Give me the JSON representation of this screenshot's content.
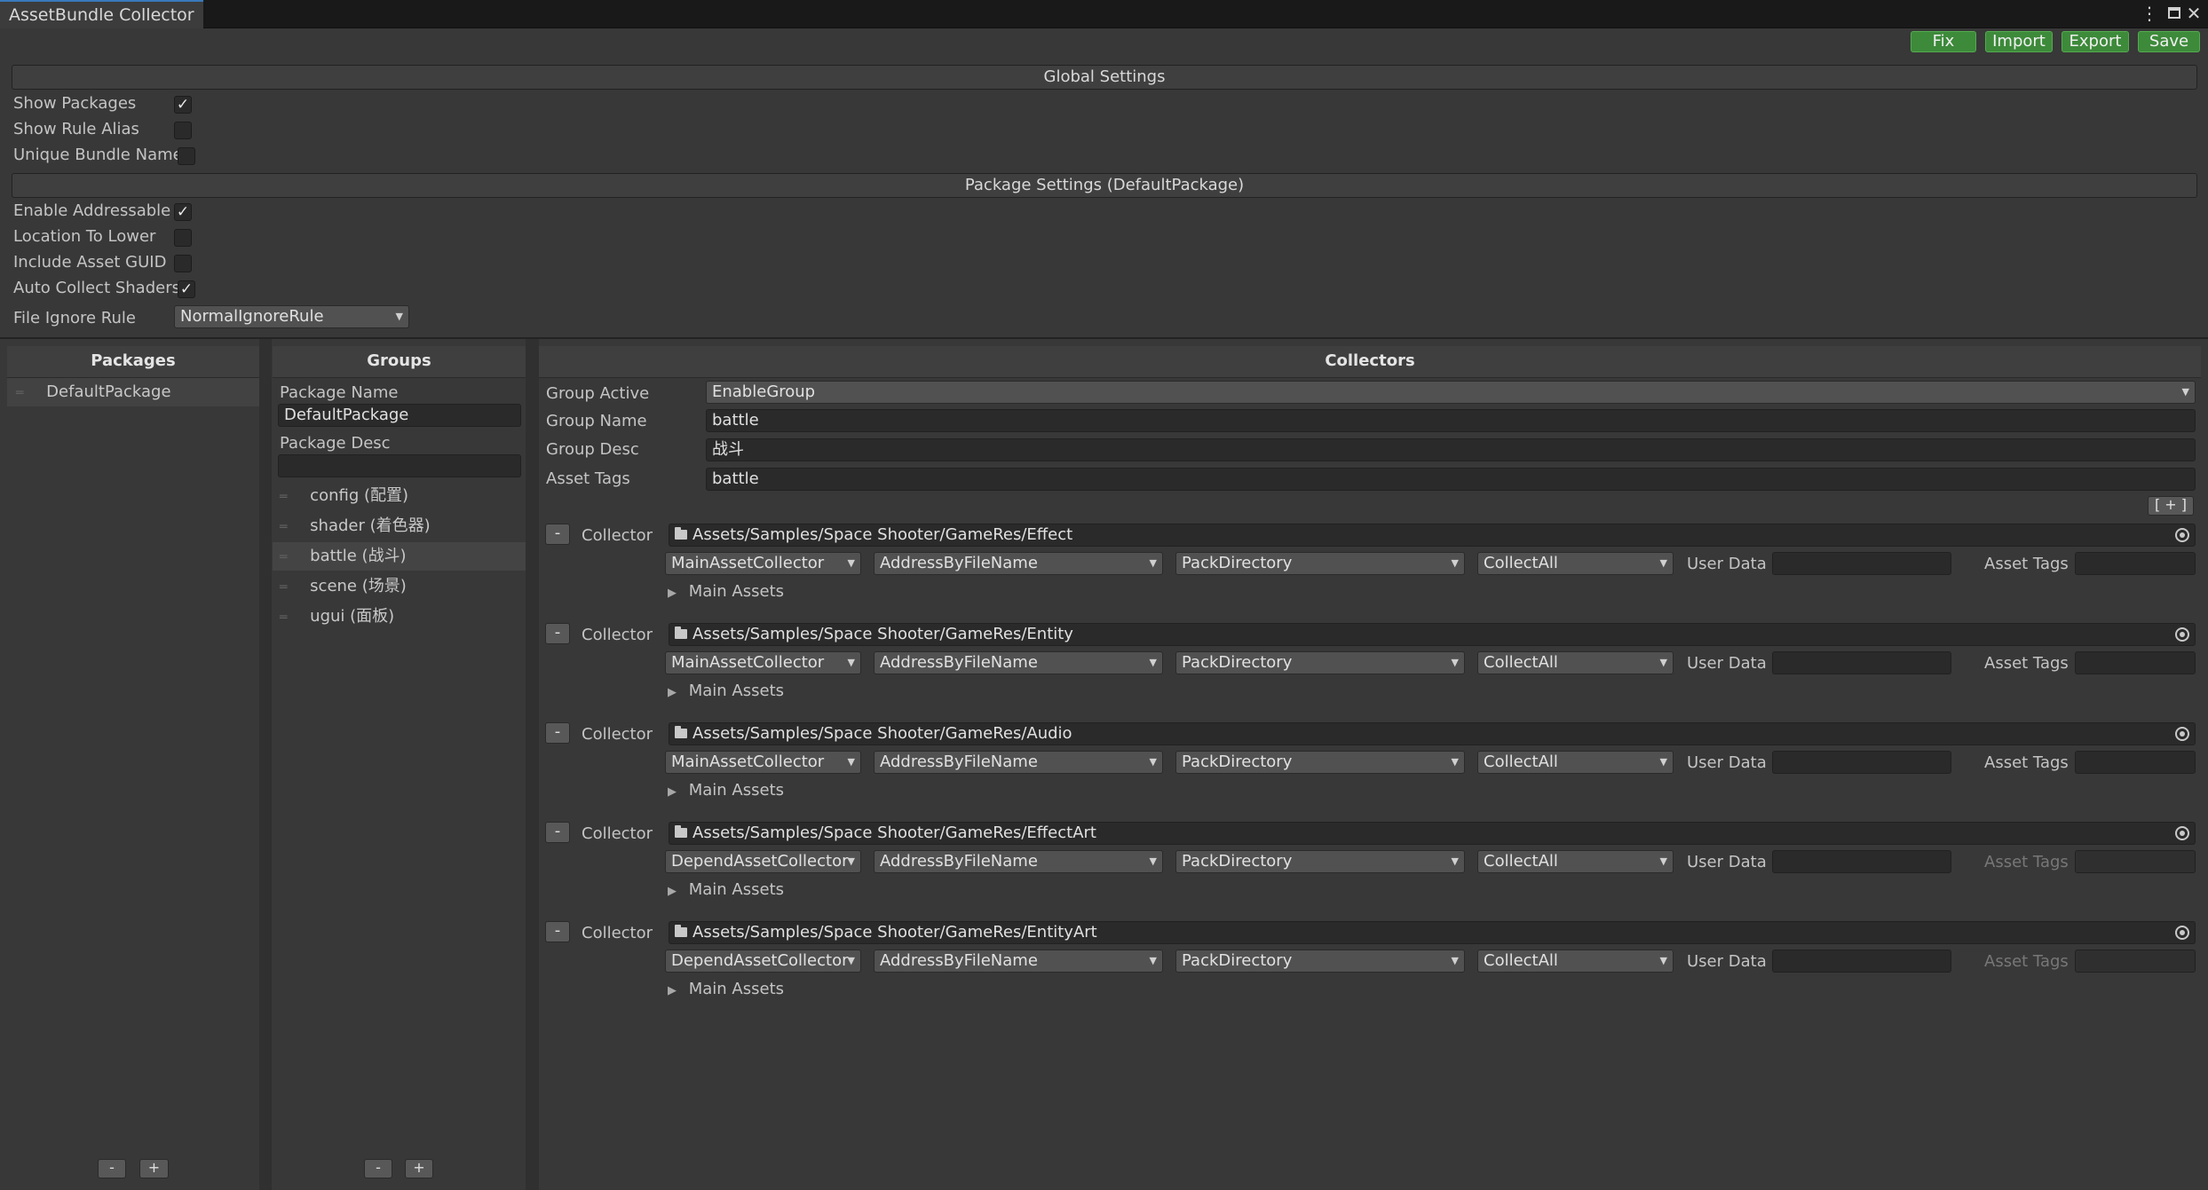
{
  "window": {
    "tab_title": "AssetBundle Collector"
  },
  "window_icons": {
    "menu": "kebab-menu-icon",
    "maximize": "maximize-icon",
    "close": "close-icon"
  },
  "toolbar": {
    "fix": "Fix",
    "import": "Import",
    "export": "Export",
    "save": "Save"
  },
  "global_settings": {
    "title": "Global Settings",
    "show_packages": {
      "label": "Show Packages",
      "checked": true
    },
    "show_rule_alias": {
      "label": "Show Rule Alias",
      "checked": false
    },
    "unique_bundle_name": {
      "label": "Unique Bundle Name",
      "checked": false
    }
  },
  "package_settings": {
    "title": "Package Settings (DefaultPackage)",
    "enable_addressable": {
      "label": "Enable Addressable",
      "checked": true
    },
    "location_to_lower": {
      "label": "Location To Lower",
      "checked": false
    },
    "include_asset_guid": {
      "label": "Include Asset GUID",
      "checked": false
    },
    "auto_collect_shaders": {
      "label": "Auto Collect Shaders",
      "checked": true
    },
    "file_ignore_rule": {
      "label": "File Ignore Rule",
      "value": "NormalIgnoreRule"
    }
  },
  "packages_panel": {
    "title": "Packages",
    "items": [
      "DefaultPackage"
    ],
    "minus": "-",
    "plus": "+"
  },
  "groups_panel": {
    "title": "Groups",
    "package_name_label": "Package Name",
    "package_name_value": "DefaultPackage",
    "package_desc_label": "Package Desc",
    "package_desc_value": "",
    "items": [
      "config (配置)",
      "shader (着色器)",
      "battle (战斗)",
      "scene (场景)",
      "ugui (面板)"
    ],
    "minus": "-",
    "plus": "+"
  },
  "collectors_panel": {
    "title": "Collectors",
    "group_active_label": "Group Active",
    "group_active_value": "EnableGroup",
    "group_name_label": "Group Name",
    "group_name_value": "battle",
    "group_desc_label": "Group Desc",
    "group_desc_value": "战斗",
    "asset_tags_label": "Asset Tags",
    "asset_tags_value": "battle",
    "add_button": "[ + ]",
    "collector_label": "Collector",
    "minus": "-",
    "user_data_label": "User Data",
    "asset_tags_field_label": "Asset Tags",
    "main_assets_label": "Main Assets",
    "collectors": [
      {
        "path": "Assets/Samples/Space Shooter/GameRes/Effect",
        "collector": "MainAssetCollector",
        "address": "AddressByFileName",
        "pack": "PackDirectory",
        "filter": "CollectAll",
        "user_data": "",
        "asset_tags": "",
        "tags_enabled": true
      },
      {
        "path": "Assets/Samples/Space Shooter/GameRes/Entity",
        "collector": "MainAssetCollector",
        "address": "AddressByFileName",
        "pack": "PackDirectory",
        "filter": "CollectAll",
        "user_data": "",
        "asset_tags": "",
        "tags_enabled": true
      },
      {
        "path": "Assets/Samples/Space Shooter/GameRes/Audio",
        "collector": "MainAssetCollector",
        "address": "AddressByFileName",
        "pack": "PackDirectory",
        "filter": "CollectAll",
        "user_data": "",
        "asset_tags": "",
        "tags_enabled": true
      },
      {
        "path": "Assets/Samples/Space Shooter/GameRes/EffectArt",
        "collector": "DependAssetCollector",
        "address": "AddressByFileName",
        "pack": "PackDirectory",
        "filter": "CollectAll",
        "user_data": "",
        "asset_tags": "",
        "tags_enabled": false
      },
      {
        "path": "Assets/Samples/Space Shooter/GameRes/EntityArt",
        "collector": "DependAssetCollector",
        "address": "AddressByFileName",
        "pack": "PackDirectory",
        "filter": "CollectAll",
        "user_data": "",
        "asset_tags": "",
        "tags_enabled": false
      }
    ]
  },
  "colors": {
    "background": "#383838",
    "toolbar_button": "#3d8a3a",
    "field": "#2a2a2a",
    "tab_accent": "#3a79bb"
  }
}
